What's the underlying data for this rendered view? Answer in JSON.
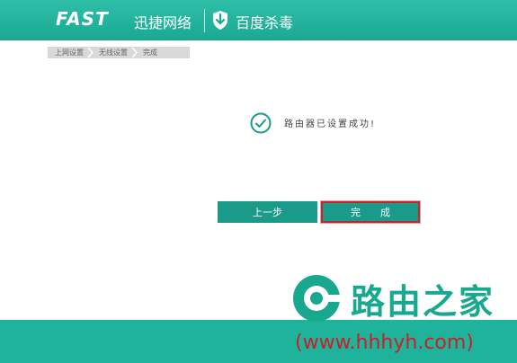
{
  "header": {
    "brand_en": "FAST",
    "brand_cn": "迅捷网络",
    "antivirus": "百度杀毒"
  },
  "breadcrumb": [
    {
      "label": "上网设置"
    },
    {
      "label": "无线设置"
    },
    {
      "label": "完成"
    }
  ],
  "status": {
    "message": "路由器已设置成功!"
  },
  "buttons": {
    "prev_label": "上一步",
    "done_label": "完成"
  },
  "watermark": {
    "title": "路由之家",
    "url": "(www.hhhyh.com)"
  },
  "colors": {
    "brand_teal": "#1aa892",
    "button_teal": "#1a9b8a",
    "highlight_red": "#c0262e"
  }
}
